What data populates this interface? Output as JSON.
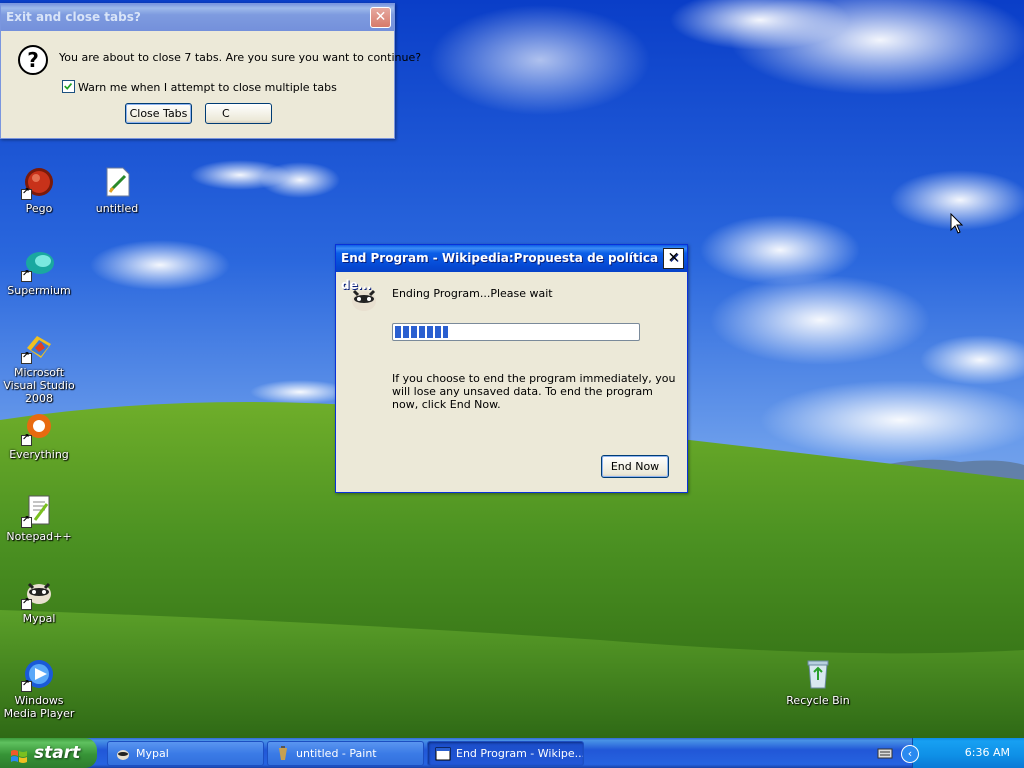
{
  "exit_dialog": {
    "title": "Exit and close tabs?",
    "message": "You are about to close 7 tabs. Are you sure you want to continue?",
    "checkbox_label": "Warn me when I attempt to close multiple tabs",
    "checkbox_checked": true,
    "close_tabs_label": "Close Tabs",
    "cancel_label": "C"
  },
  "end_program_dialog": {
    "title": "End Program - Wikipedia:Propuesta de política de...",
    "status": "Ending Program...Please wait",
    "warning": "If you choose to end the program immediately, you will lose any unsaved data. To end the program now, click End Now.",
    "progress": 0.22,
    "end_now_label": "End Now"
  },
  "desktop_icons": [
    {
      "label": "Pego",
      "icon": "pego-icon"
    },
    {
      "label": "untitled",
      "icon": "paint-file-icon"
    },
    {
      "label": "Supermium",
      "icon": "supermium-icon"
    },
    {
      "label": "Microsoft Visual Studio 2008",
      "icon": "visual-studio-icon"
    },
    {
      "label": "Everything",
      "icon": "everything-icon"
    },
    {
      "label": "Notepad++",
      "icon": "notepadpp-icon"
    },
    {
      "label": "Mypal",
      "icon": "mypal-icon"
    },
    {
      "label": "Windows Media Player",
      "icon": "media-player-icon"
    },
    {
      "label": "Recycle Bin",
      "icon": "recycle-bin-icon"
    }
  ],
  "taskbar": {
    "start_label": "start",
    "tasks": [
      {
        "label": "Mypal",
        "icon": "mypal-icon",
        "active": false
      },
      {
        "label": "untitled - Paint",
        "icon": "paint-icon",
        "active": false
      },
      {
        "label": "End Program - Wikipe...",
        "icon": "window-icon",
        "active": true
      }
    ],
    "clock": "6:36 AM"
  },
  "colors": {
    "titlebar_active": "#0b5ee8",
    "progress_fill": "#2a5fd0",
    "taskbar_blue": "#2157d7",
    "start_green": "#379437"
  }
}
